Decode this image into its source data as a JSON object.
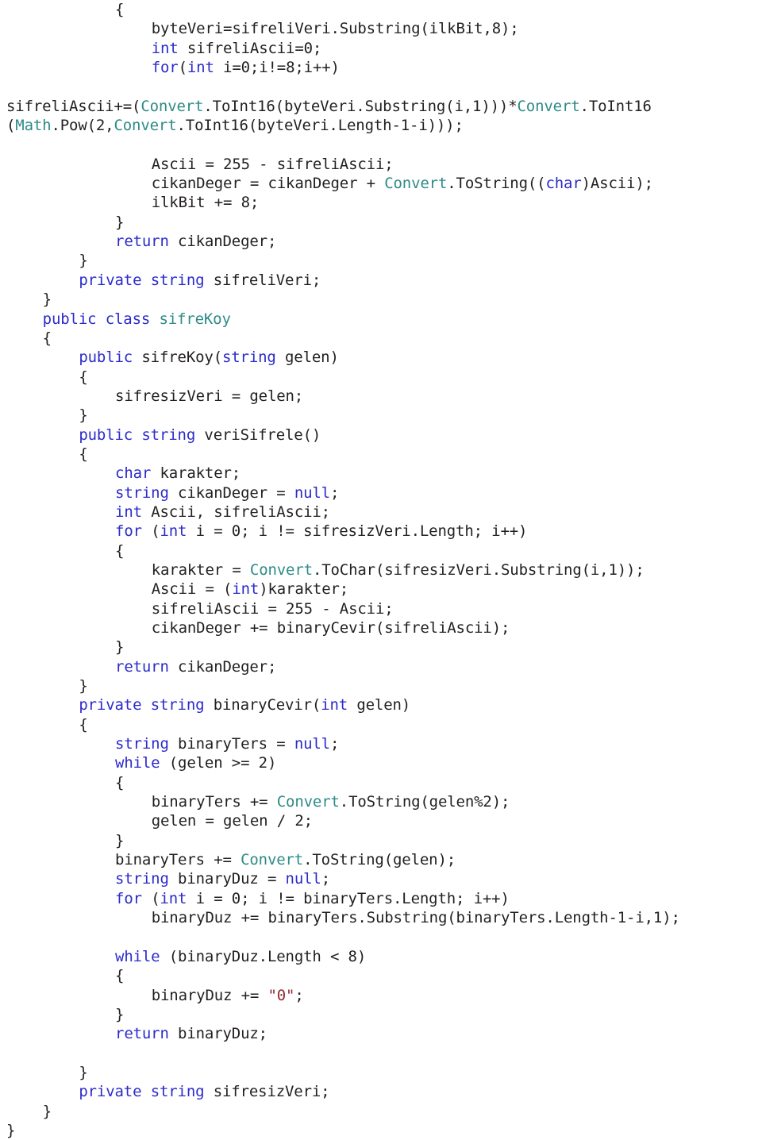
{
  "document": {
    "language": "csharp",
    "colors": {
      "background": "#ffffff",
      "plain_text": "#231f20",
      "keyword": "#2b2bcc",
      "type_name": "#2e8b87",
      "string_literal": "#8f2a35"
    },
    "lines": [
      {
        "id": "l1",
        "indent": 12,
        "segments": [
          {
            "t": "{",
            "c": "pln"
          }
        ]
      },
      {
        "id": "l2",
        "indent": 16,
        "segments": [
          {
            "t": "byteVeri=sifreliVeri.Substring(ilkBit,8);",
            "c": "pln"
          }
        ]
      },
      {
        "id": "l3",
        "indent": 16,
        "segments": [
          {
            "t": "int",
            "c": "kw"
          },
          {
            "t": " sifreliAscii=0;",
            "c": "pln"
          }
        ]
      },
      {
        "id": "l4",
        "indent": 16,
        "segments": [
          {
            "t": "for",
            "c": "kw"
          },
          {
            "t": "(",
            "c": "pln"
          },
          {
            "t": "int",
            "c": "kw"
          },
          {
            "t": " i=0;i!=8;i++)",
            "c": "pln"
          }
        ]
      },
      {
        "id": "l5",
        "indent": 0,
        "blank": true,
        "segments": []
      },
      {
        "id": "l6",
        "indent": 0,
        "segments": [
          {
            "t": "sifreliAscii+=(",
            "c": "pln"
          },
          {
            "t": "Convert",
            "c": "typ"
          },
          {
            "t": ".ToInt16(byteVeri.Substring(i,1)))*",
            "c": "pln"
          },
          {
            "t": "Convert",
            "c": "typ"
          },
          {
            "t": ".ToInt16",
            "c": "pln"
          }
        ]
      },
      {
        "id": "l7",
        "indent": 0,
        "segments": [
          {
            "t": "(",
            "c": "pln"
          },
          {
            "t": "Math",
            "c": "typ"
          },
          {
            "t": ".Pow(2,",
            "c": "pln"
          },
          {
            "t": "Convert",
            "c": "typ"
          },
          {
            "t": ".ToInt16(byteVeri.Length-1-i)));",
            "c": "pln"
          }
        ]
      },
      {
        "id": "l8",
        "indent": 0,
        "blank": true,
        "segments": []
      },
      {
        "id": "l9",
        "indent": 16,
        "segments": [
          {
            "t": "Ascii = 255 - sifreliAscii;",
            "c": "pln"
          }
        ]
      },
      {
        "id": "l10",
        "indent": 16,
        "segments": [
          {
            "t": "cikanDeger = cikanDeger + ",
            "c": "pln"
          },
          {
            "t": "Convert",
            "c": "typ"
          },
          {
            "t": ".ToString((",
            "c": "pln"
          },
          {
            "t": "char",
            "c": "kw"
          },
          {
            "t": ")Ascii);",
            "c": "pln"
          }
        ]
      },
      {
        "id": "l11",
        "indent": 16,
        "segments": [
          {
            "t": "ilkBit += 8;",
            "c": "pln"
          }
        ]
      },
      {
        "id": "l12",
        "indent": 12,
        "segments": [
          {
            "t": "}",
            "c": "pln"
          }
        ]
      },
      {
        "id": "l13",
        "indent": 12,
        "segments": [
          {
            "t": "return",
            "c": "kw"
          },
          {
            "t": " cikanDeger;",
            "c": "pln"
          }
        ]
      },
      {
        "id": "l14",
        "indent": 8,
        "segments": [
          {
            "t": "}",
            "c": "pln"
          }
        ]
      },
      {
        "id": "l15",
        "indent": 8,
        "segments": [
          {
            "t": "private",
            "c": "kw"
          },
          {
            "t": " ",
            "c": "pln"
          },
          {
            "t": "string",
            "c": "kw"
          },
          {
            "t": " sifreliVeri;",
            "c": "pln"
          }
        ]
      },
      {
        "id": "l16",
        "indent": 4,
        "segments": [
          {
            "t": "}",
            "c": "pln"
          }
        ]
      },
      {
        "id": "l17",
        "indent": 4,
        "segments": [
          {
            "t": "public",
            "c": "kw"
          },
          {
            "t": " ",
            "c": "pln"
          },
          {
            "t": "class",
            "c": "kw"
          },
          {
            "t": " ",
            "c": "pln"
          },
          {
            "t": "sifreKoy",
            "c": "typ"
          }
        ]
      },
      {
        "id": "l18",
        "indent": 4,
        "segments": [
          {
            "t": "{",
            "c": "pln"
          }
        ]
      },
      {
        "id": "l19",
        "indent": 8,
        "segments": [
          {
            "t": "public",
            "c": "kw"
          },
          {
            "t": " sifreKoy(",
            "c": "pln"
          },
          {
            "t": "string",
            "c": "kw"
          },
          {
            "t": " gelen)",
            "c": "pln"
          }
        ]
      },
      {
        "id": "l20",
        "indent": 8,
        "segments": [
          {
            "t": "{",
            "c": "pln"
          }
        ]
      },
      {
        "id": "l21",
        "indent": 12,
        "segments": [
          {
            "t": "sifresizVeri = gelen;",
            "c": "pln"
          }
        ]
      },
      {
        "id": "l22",
        "indent": 8,
        "segments": [
          {
            "t": "}",
            "c": "pln"
          }
        ]
      },
      {
        "id": "l23",
        "indent": 8,
        "segments": [
          {
            "t": "public",
            "c": "kw"
          },
          {
            "t": " ",
            "c": "pln"
          },
          {
            "t": "string",
            "c": "kw"
          },
          {
            "t": " veriSifrele()",
            "c": "pln"
          }
        ]
      },
      {
        "id": "l24",
        "indent": 8,
        "segments": [
          {
            "t": "{",
            "c": "pln"
          }
        ]
      },
      {
        "id": "l25",
        "indent": 12,
        "segments": [
          {
            "t": "char",
            "c": "kw"
          },
          {
            "t": " karakter;",
            "c": "pln"
          }
        ]
      },
      {
        "id": "l26",
        "indent": 12,
        "segments": [
          {
            "t": "string",
            "c": "kw"
          },
          {
            "t": " cikanDeger = ",
            "c": "pln"
          },
          {
            "t": "null",
            "c": "kw"
          },
          {
            "t": ";",
            "c": "pln"
          }
        ]
      },
      {
        "id": "l27",
        "indent": 12,
        "segments": [
          {
            "t": "int",
            "c": "kw"
          },
          {
            "t": " Ascii, sifreliAscii;",
            "c": "pln"
          }
        ]
      },
      {
        "id": "l28",
        "indent": 12,
        "segments": [
          {
            "t": "for",
            "c": "kw"
          },
          {
            "t": " (",
            "c": "pln"
          },
          {
            "t": "int",
            "c": "kw"
          },
          {
            "t": " i = 0; i != sifresizVeri.Length; i++)",
            "c": "pln"
          }
        ]
      },
      {
        "id": "l29",
        "indent": 12,
        "segments": [
          {
            "t": "{",
            "c": "pln"
          }
        ]
      },
      {
        "id": "l30",
        "indent": 16,
        "segments": [
          {
            "t": "karakter = ",
            "c": "pln"
          },
          {
            "t": "Convert",
            "c": "typ"
          },
          {
            "t": ".ToChar(sifresizVeri.Substring(i,1));",
            "c": "pln"
          }
        ]
      },
      {
        "id": "l31",
        "indent": 16,
        "segments": [
          {
            "t": "Ascii = (",
            "c": "pln"
          },
          {
            "t": "int",
            "c": "kw"
          },
          {
            "t": ")karakter;",
            "c": "pln"
          }
        ]
      },
      {
        "id": "l32",
        "indent": 16,
        "segments": [
          {
            "t": "sifreliAscii = 255 - Ascii;",
            "c": "pln"
          }
        ]
      },
      {
        "id": "l33",
        "indent": 16,
        "segments": [
          {
            "t": "cikanDeger += binaryCevir(sifreliAscii);",
            "c": "pln"
          }
        ]
      },
      {
        "id": "l34",
        "indent": 12,
        "segments": [
          {
            "t": "}",
            "c": "pln"
          }
        ]
      },
      {
        "id": "l35",
        "indent": 12,
        "segments": [
          {
            "t": "return",
            "c": "kw"
          },
          {
            "t": " cikanDeger;",
            "c": "pln"
          }
        ]
      },
      {
        "id": "l36",
        "indent": 8,
        "segments": [
          {
            "t": "}",
            "c": "pln"
          }
        ]
      },
      {
        "id": "l37",
        "indent": 8,
        "segments": [
          {
            "t": "private",
            "c": "kw"
          },
          {
            "t": " ",
            "c": "pln"
          },
          {
            "t": "string",
            "c": "kw"
          },
          {
            "t": " binaryCevir(",
            "c": "pln"
          },
          {
            "t": "int",
            "c": "kw"
          },
          {
            "t": " gelen)",
            "c": "pln"
          }
        ]
      },
      {
        "id": "l38",
        "indent": 8,
        "segments": [
          {
            "t": "{",
            "c": "pln"
          }
        ]
      },
      {
        "id": "l39",
        "indent": 12,
        "segments": [
          {
            "t": "string",
            "c": "kw"
          },
          {
            "t": " binaryTers = ",
            "c": "pln"
          },
          {
            "t": "null",
            "c": "kw"
          },
          {
            "t": ";",
            "c": "pln"
          }
        ]
      },
      {
        "id": "l40",
        "indent": 12,
        "segments": [
          {
            "t": "while",
            "c": "kw"
          },
          {
            "t": " (gelen >= 2)",
            "c": "pln"
          }
        ]
      },
      {
        "id": "l41",
        "indent": 12,
        "segments": [
          {
            "t": "{",
            "c": "pln"
          }
        ]
      },
      {
        "id": "l42",
        "indent": 16,
        "segments": [
          {
            "t": "binaryTers += ",
            "c": "pln"
          },
          {
            "t": "Convert",
            "c": "typ"
          },
          {
            "t": ".ToString(gelen%2);",
            "c": "pln"
          }
        ]
      },
      {
        "id": "l43",
        "indent": 16,
        "segments": [
          {
            "t": "gelen = gelen / 2;",
            "c": "pln"
          }
        ]
      },
      {
        "id": "l44",
        "indent": 12,
        "segments": [
          {
            "t": "}",
            "c": "pln"
          }
        ]
      },
      {
        "id": "l45",
        "indent": 12,
        "segments": [
          {
            "t": "binaryTers += ",
            "c": "pln"
          },
          {
            "t": "Convert",
            "c": "typ"
          },
          {
            "t": ".ToString(gelen);",
            "c": "pln"
          }
        ]
      },
      {
        "id": "l46",
        "indent": 12,
        "segments": [
          {
            "t": "string",
            "c": "kw"
          },
          {
            "t": " binaryDuz = ",
            "c": "pln"
          },
          {
            "t": "null",
            "c": "kw"
          },
          {
            "t": ";",
            "c": "pln"
          }
        ]
      },
      {
        "id": "l47",
        "indent": 12,
        "segments": [
          {
            "t": "for",
            "c": "kw"
          },
          {
            "t": " (",
            "c": "pln"
          },
          {
            "t": "int",
            "c": "kw"
          },
          {
            "t": " i = 0; i != binaryTers.Length; i++)",
            "c": "pln"
          }
        ]
      },
      {
        "id": "l48",
        "indent": 16,
        "segments": [
          {
            "t": "binaryDuz += binaryTers.Substring(binaryTers.Length-1-i,1);",
            "c": "pln"
          }
        ]
      },
      {
        "id": "l49",
        "indent": 0,
        "blank": true,
        "segments": []
      },
      {
        "id": "l50",
        "indent": 12,
        "segments": [
          {
            "t": "while",
            "c": "kw"
          },
          {
            "t": " (binaryDuz.Length < 8)",
            "c": "pln"
          }
        ]
      },
      {
        "id": "l51",
        "indent": 12,
        "segments": [
          {
            "t": "{",
            "c": "pln"
          }
        ]
      },
      {
        "id": "l52",
        "indent": 16,
        "segments": [
          {
            "t": "binaryDuz += ",
            "c": "pln"
          },
          {
            "t": "\"0\"",
            "c": "str"
          },
          {
            "t": ";",
            "c": "pln"
          }
        ]
      },
      {
        "id": "l53",
        "indent": 12,
        "segments": [
          {
            "t": "}",
            "c": "pln"
          }
        ]
      },
      {
        "id": "l54",
        "indent": 12,
        "segments": [
          {
            "t": "return",
            "c": "kw"
          },
          {
            "t": " binaryDuz;",
            "c": "pln"
          }
        ]
      },
      {
        "id": "l55",
        "indent": 0,
        "blank": true,
        "segments": []
      },
      {
        "id": "l56",
        "indent": 8,
        "segments": [
          {
            "t": "}",
            "c": "pln"
          }
        ]
      },
      {
        "id": "l57",
        "indent": 8,
        "segments": [
          {
            "t": "private",
            "c": "kw"
          },
          {
            "t": " ",
            "c": "pln"
          },
          {
            "t": "string",
            "c": "kw"
          },
          {
            "t": " sifresizVeri;",
            "c": "pln"
          }
        ]
      },
      {
        "id": "l58",
        "indent": 4,
        "segments": [
          {
            "t": "}",
            "c": "pln"
          }
        ]
      },
      {
        "id": "l59",
        "indent": 0,
        "segments": [
          {
            "t": "}",
            "c": "pln"
          }
        ]
      }
    ]
  }
}
